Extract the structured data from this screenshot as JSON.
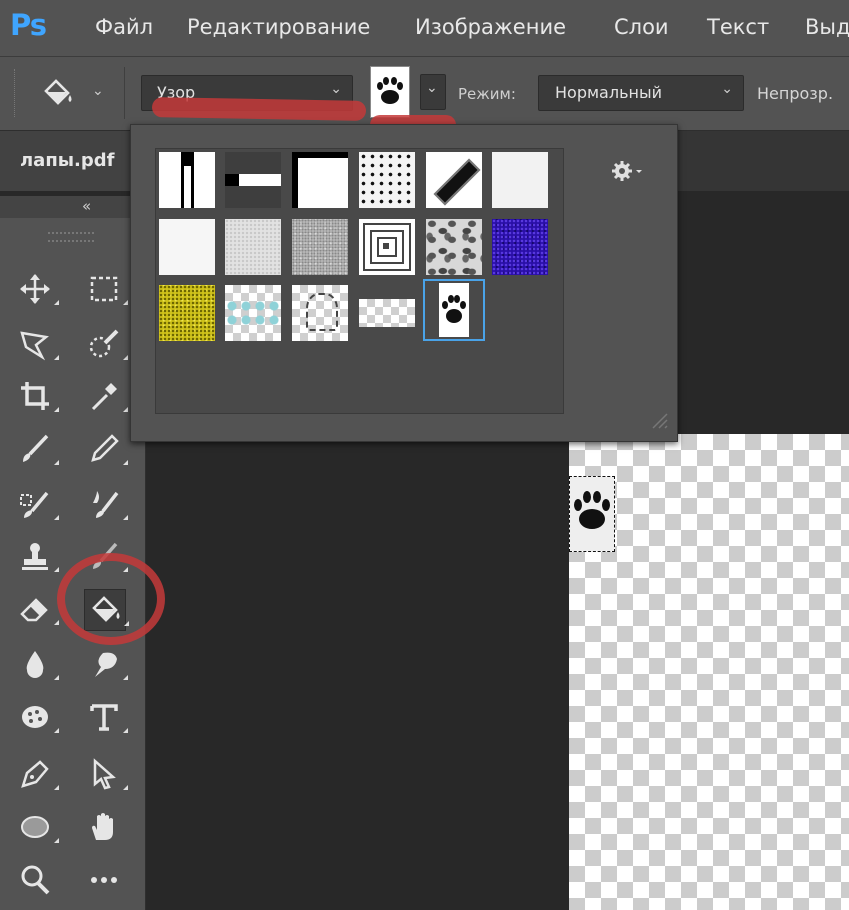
{
  "app": {
    "logo": "Ps"
  },
  "menu": {
    "items": [
      "Файл",
      "Редактирование",
      "Изображение",
      "Слои",
      "Текст",
      "Выд"
    ]
  },
  "options_bar": {
    "fill_source": "Узор",
    "mode_label": "Режим:",
    "mode_value": "Нормальный",
    "opacity_label": "Непрозр.",
    "pattern_selected": "paw-print"
  },
  "document": {
    "tab_title": "лапы.pdf"
  },
  "toolbar": {
    "collapse_glyph": "«",
    "tools": [
      "move-icon",
      "marquee-icon",
      "lasso-icon",
      "quick-selection-icon",
      "crop-icon",
      "eyedropper-icon",
      "brush-icon",
      "pencil-icon",
      "clone-brush-icon",
      "blur-brush-icon",
      "stamp-icon",
      "history-brush-icon",
      "eraser-icon",
      "paint-bucket-icon",
      "drop-icon",
      "smudge-icon",
      "sponge-icon",
      "type-icon",
      "pen-icon",
      "path-select-icon",
      "ellipse-icon",
      "hand-icon",
      "zoom-icon",
      "more-icon"
    ],
    "active_tool": "paint-bucket-icon"
  },
  "pattern_picker": {
    "gear_icon": "gear-icon",
    "patterns": [
      "vertical-bar",
      "horizontal-bar",
      "frame",
      "dots",
      "diagonal",
      "light-noise",
      "white-noise",
      "gray-noise",
      "dense-noise",
      "concentric-squares",
      "camouflage",
      "purple-noise",
      "yellow-noise",
      "cyan-pattern",
      "sketch",
      "small-tiles",
      "paw-print"
    ],
    "selected": "paw-print"
  },
  "colors": {
    "accent": "#4aa3e8",
    "annotation": "#c43a3a",
    "panel": "#535353",
    "workspace": "#282828"
  }
}
